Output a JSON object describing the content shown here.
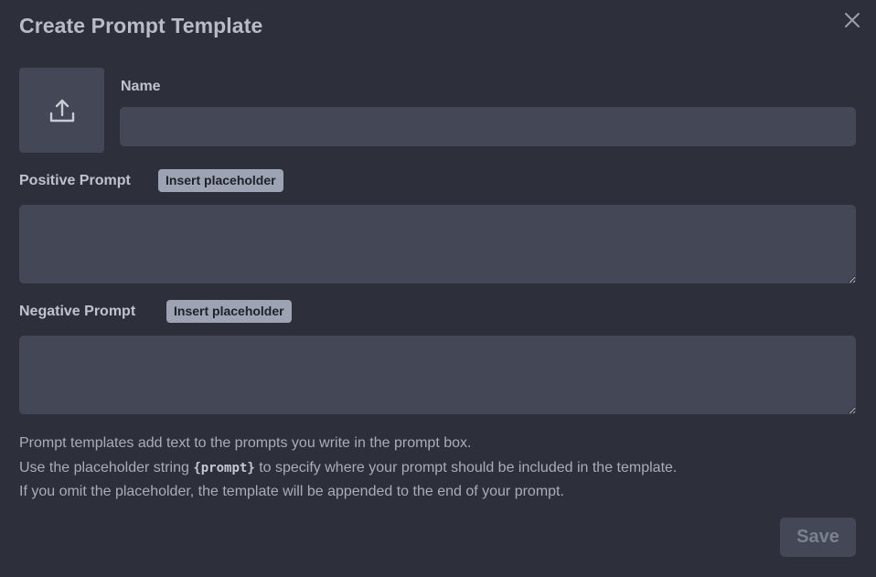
{
  "dialog": {
    "title": "Create Prompt Template",
    "close_icon": "close-icon"
  },
  "upload": {
    "icon": "upload-icon"
  },
  "name_field": {
    "label": "Name",
    "value": "",
    "placeholder": ""
  },
  "positive_prompt": {
    "label": "Positive Prompt",
    "insert_label": "Insert placeholder",
    "value": ""
  },
  "negative_prompt": {
    "label": "Negative Prompt",
    "insert_label": "Insert placeholder",
    "value": ""
  },
  "help": {
    "line1": "Prompt templates add text to the prompts you write in the prompt box.",
    "line2_before": "Use the placeholder string ",
    "line2_code": "{prompt}",
    "line2_after": " to specify where your prompt should be included in the template.",
    "line3": "If you omit the placeholder, the template will be appended to the end of your prompt."
  },
  "footer": {
    "save_label": "Save"
  },
  "colors": {
    "background": "#2d303a",
    "field": "#434756",
    "chip": "#9ea3b4"
  }
}
